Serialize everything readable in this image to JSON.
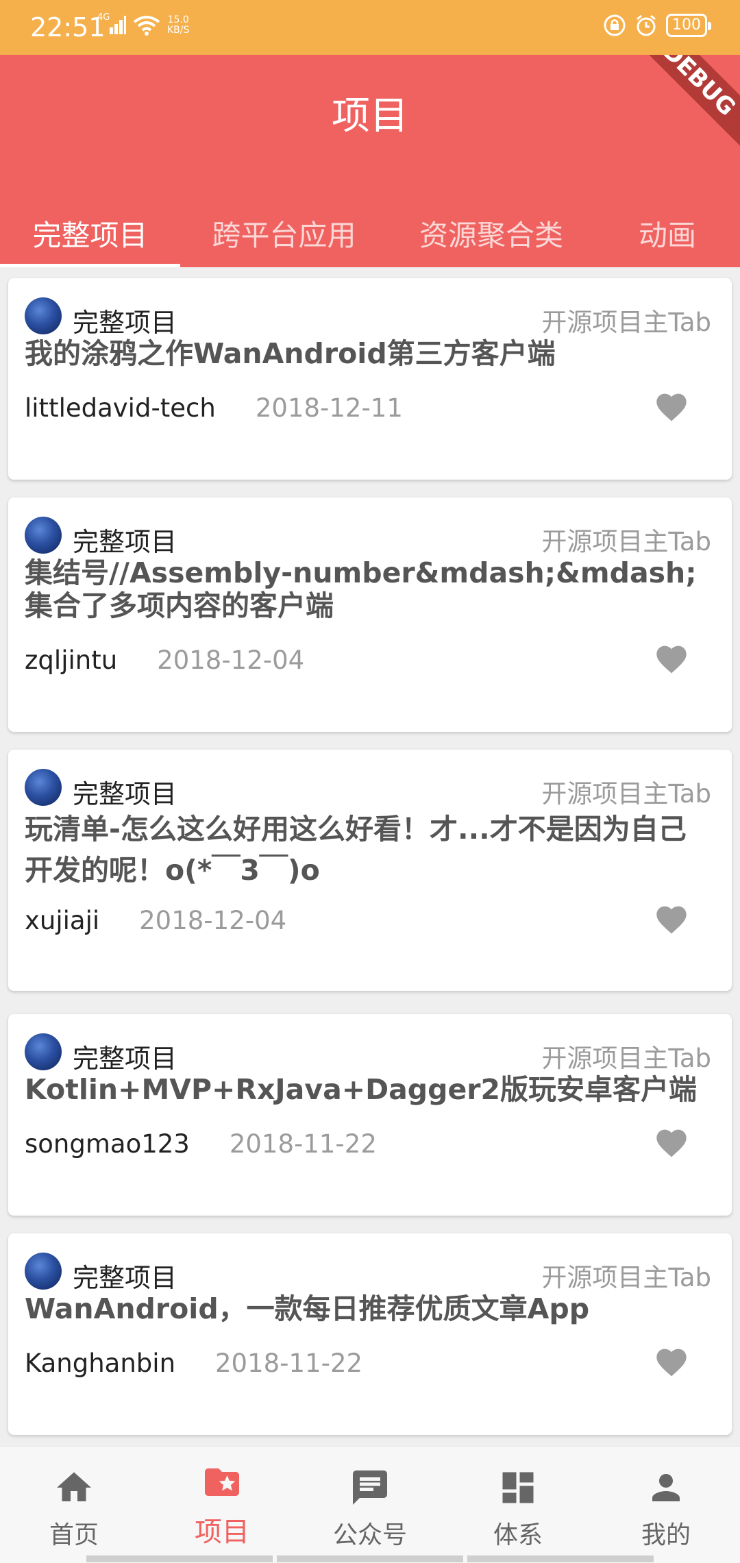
{
  "status_bar": {
    "time": "22:51",
    "network_type": "4G",
    "network_speed": "15.0",
    "network_unit": "KB/S",
    "battery": "100"
  },
  "app_bar": {
    "title": "项目",
    "debug_banner": "DEBUG",
    "color": "#ef625f"
  },
  "tabs": [
    {
      "label": "完整项目",
      "active": true
    },
    {
      "label": "跨平台应用",
      "active": false
    },
    {
      "label": "资源聚合类",
      "active": false
    },
    {
      "label": "动画",
      "active": false
    }
  ],
  "projects": [
    {
      "category": "完整项目",
      "tag": "开源项目主Tab",
      "title": "我的涂鸦之作WanAndroid第三方客户端",
      "author": "littledavid-tech",
      "date": "2018-12-11"
    },
    {
      "category": "完整项目",
      "tag": "开源项目主Tab",
      "title": "集结号//Assembly-number&mdash;&mdash;集合了多项内容的客户端",
      "author": "zqljintu",
      "date": "2018-12-04"
    },
    {
      "category": "完整项目",
      "tag": "开源项目主Tab",
      "title": "玩清单-怎么这么好用这么好看！才...才不是因为自己开发的呢！o(*￣3￣)o",
      "author": "xujiaji",
      "date": "2018-12-04"
    },
    {
      "category": "完整项目",
      "tag": "开源项目主Tab",
      "title": "Kotlin+MVP+RxJava+Dagger2版玩安卓客户端",
      "author": "songmao123",
      "date": "2018-11-22"
    },
    {
      "category": "完整项目",
      "tag": "开源项目主Tab",
      "title": "WanAndroid，一款每日推荐优质文章App",
      "author": "Kanghanbin",
      "date": "2018-11-22"
    }
  ],
  "bottom_nav": [
    {
      "label": "首页",
      "icon": "home-icon",
      "active": false
    },
    {
      "label": "项目",
      "icon": "folder-star-icon",
      "active": true
    },
    {
      "label": "公众号",
      "icon": "chat-icon",
      "active": false
    },
    {
      "label": "体系",
      "icon": "dashboard-icon",
      "active": false
    },
    {
      "label": "我的",
      "icon": "person-icon",
      "active": false
    }
  ],
  "colors": {
    "status_bar": "#f6b04b",
    "primary": "#ef625f",
    "like_icon": "#9e9e9e"
  }
}
